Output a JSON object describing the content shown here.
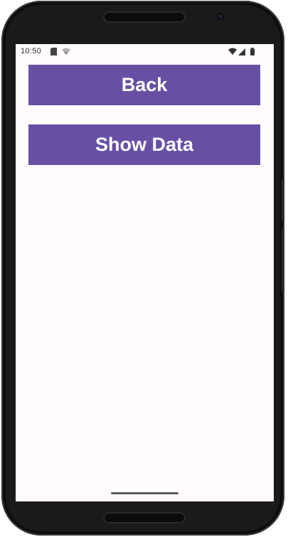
{
  "status_bar": {
    "time": "10:50",
    "icons": [
      "sd-card-icon",
      "wifi-off-icon",
      "wifi-icon",
      "signal-icon",
      "battery-icon"
    ]
  },
  "buttons": {
    "back_label": "Back",
    "show_data_label": "Show Data"
  },
  "colors": {
    "button_background": "#6750a4",
    "button_text": "#ffffff",
    "screen_background": "#fffbfe"
  }
}
